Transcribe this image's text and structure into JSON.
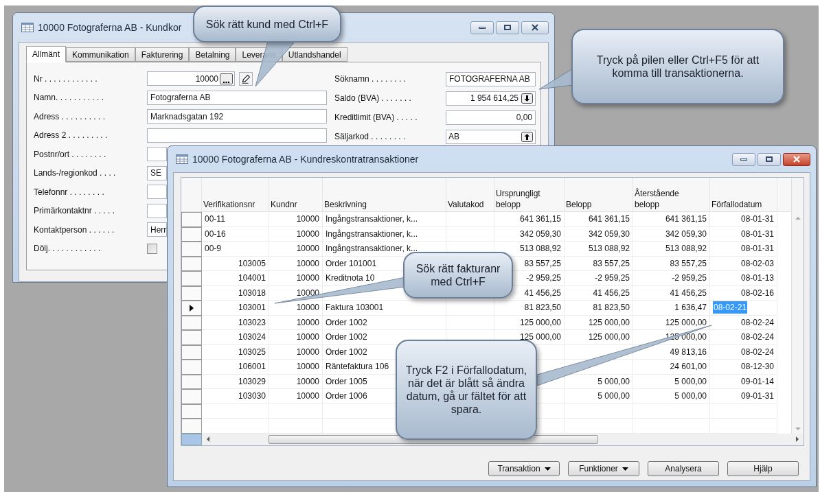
{
  "customer_window": {
    "title": "10000 Fotograferna AB - Kundkor",
    "tabs": [
      {
        "label": "Allmänt",
        "selected": true
      },
      {
        "label": "Kommunikation",
        "selected": false
      },
      {
        "label": "Fakturering",
        "selected": false
      },
      {
        "label": "Betalning",
        "selected": false
      },
      {
        "label": "Leverans",
        "selected": false
      },
      {
        "label": "Utlandshandel",
        "selected": false
      }
    ],
    "left_fields": [
      {
        "label": "Nr . . . . . . . . . . . .",
        "value": "10000",
        "kind": "lookup"
      },
      {
        "label": "Namn. . . . . . . . . . .",
        "value": "Fotograferna AB",
        "kind": "text"
      },
      {
        "label": "Adress . . . . . . . . . .",
        "value": "Marknadsgatan 192",
        "kind": "text"
      },
      {
        "label": "Adress 2 . . . . . . . . .",
        "kind": "text"
      },
      {
        "label": "Postnr/ort . . . . . . . .",
        "kind": "text"
      },
      {
        "label": "Lands-/regionkod . . . .",
        "value": "SE",
        "kind": "text"
      },
      {
        "label": "Telefonnr . . . . . . . .",
        "kind": "text"
      },
      {
        "label": "Primärkontaktnr . . . . .",
        "kind": "text"
      },
      {
        "label": "Kontaktperson . . . . . .",
        "value": "Herr",
        "kind": "text"
      },
      {
        "label": "Dölj. . . . . . . . . . . .",
        "kind": "checkbox",
        "checked": false
      }
    ],
    "right_fields": [
      {
        "label": "Söknamn . . . . . . . .",
        "value": "FOTOGRAFERNA AB",
        "kind": "text"
      },
      {
        "label": "Saldo (BVA) . . . . . . .",
        "value": "1 954 614,25",
        "kind": "drilldown"
      },
      {
        "label": "Kreditlimit (BVA) . . . . .",
        "value": "0,00",
        "kind": "number"
      },
      {
        "label": "Säljarkod . . . . . . . .",
        "value": "AB",
        "kind": "lookup_up"
      }
    ]
  },
  "transactions_window": {
    "title": "10000 Fotograferna AB - Kundreskontratransaktioner",
    "columns": [
      "Verifikationsnr",
      "Kundnr",
      "Beskrivning",
      "Valutakod",
      "Ursprungligt belopp",
      "Belopp",
      "Återstående belopp",
      "Förfallodatum"
    ],
    "rows": [
      {
        "kind": "opening",
        "selected": false,
        "cells": [
          "00-11",
          "10000",
          "Ingångstransaktioner, k...",
          null,
          "641 361,15",
          "641 361,15",
          "641 361,15",
          "08-01-31"
        ]
      },
      {
        "kind": "opening",
        "selected": false,
        "cells": [
          "00-16",
          "10000",
          "Ingångstransaktioner, k...",
          null,
          "342 059,30",
          "342 059,30",
          "342 059,30",
          "08-01-31"
        ]
      },
      {
        "kind": "opening",
        "selected": false,
        "cells": [
          "00-9",
          "10000",
          "Ingångstransaktioner, k...",
          null,
          "513 088,92",
          "513 088,92",
          "513 088,92",
          "08-01-31"
        ]
      },
      {
        "kind": "entry",
        "selected": false,
        "cells": [
          "103005",
          "10000",
          "Order 101001",
          null,
          "83 557,25",
          "83 557,25",
          "83 557,25",
          "08-02-03"
        ]
      },
      {
        "kind": "entry",
        "selected": false,
        "cells": [
          "104001",
          "10000",
          "Kreditnota 10",
          null,
          "-2 959,25",
          "-2 959,25",
          "-2 959,25",
          "08-01-13"
        ]
      },
      {
        "kind": "entry",
        "selected": false,
        "cells": [
          "103018",
          "10000",
          null,
          null,
          "41 456,25",
          "41 456,25",
          "41 456,25",
          "08-02-16"
        ]
      },
      {
        "kind": "entry",
        "selected": true,
        "cells": [
          "103001",
          "10000",
          "Faktura 103001",
          null,
          "81 823,50",
          "81 823,50",
          "1 636,47",
          "08-02-21"
        ]
      },
      {
        "kind": "entry",
        "selected": false,
        "cells": [
          "103023",
          "10000",
          "Order 1002",
          null,
          "125 000,00",
          "125 000,00",
          "125 000,00",
          "08-02-24"
        ]
      },
      {
        "kind": "entry",
        "selected": false,
        "cells": [
          "103024",
          "10000",
          "Order 1002",
          null,
          "125 000,00",
          "125 000,00",
          "125 000,00",
          "08-02-24"
        ]
      },
      {
        "kind": "entry",
        "selected": false,
        "cells": [
          "103025",
          "10000",
          "Order 1002",
          null,
          null,
          null,
          "49 813,16",
          "08-02-24"
        ]
      },
      {
        "kind": "entry",
        "selected": false,
        "cells": [
          "106001",
          "10000",
          "Räntefaktura 106",
          null,
          null,
          null,
          "24 601,00",
          "08-12-30"
        ]
      },
      {
        "kind": "entry",
        "selected": false,
        "cells": [
          "103029",
          "10000",
          "Order 1005",
          null,
          null,
          "5 000,00",
          "5 000,00",
          "09-01-14"
        ]
      },
      {
        "kind": "entry",
        "selected": false,
        "cells": [
          "103030",
          "10000",
          "Order 1006",
          null,
          null,
          "5 000,00",
          "5 000,00",
          "09-01-31"
        ]
      }
    ],
    "buttons": [
      {
        "label": "Transaktion",
        "kind": "menu"
      },
      {
        "label": "Funktioner",
        "kind": "menu"
      },
      {
        "label": "Analysera",
        "kind": "plain"
      },
      {
        "label": "Hjälp",
        "kind": "plain"
      }
    ]
  },
  "callouts": [
    {
      "text": "Sök rätt kund med Ctrl+F"
    },
    {
      "text": "Tryck på pilen eller Ctrl+F5 för att komma till transaktionerna."
    },
    {
      "text": "Sök rätt fakturanr med Ctrl+F"
    },
    {
      "text": "Tryck F2 i Förfallodatum, när det är blått så ändra datum, gå ur fältet för att spara."
    }
  ]
}
